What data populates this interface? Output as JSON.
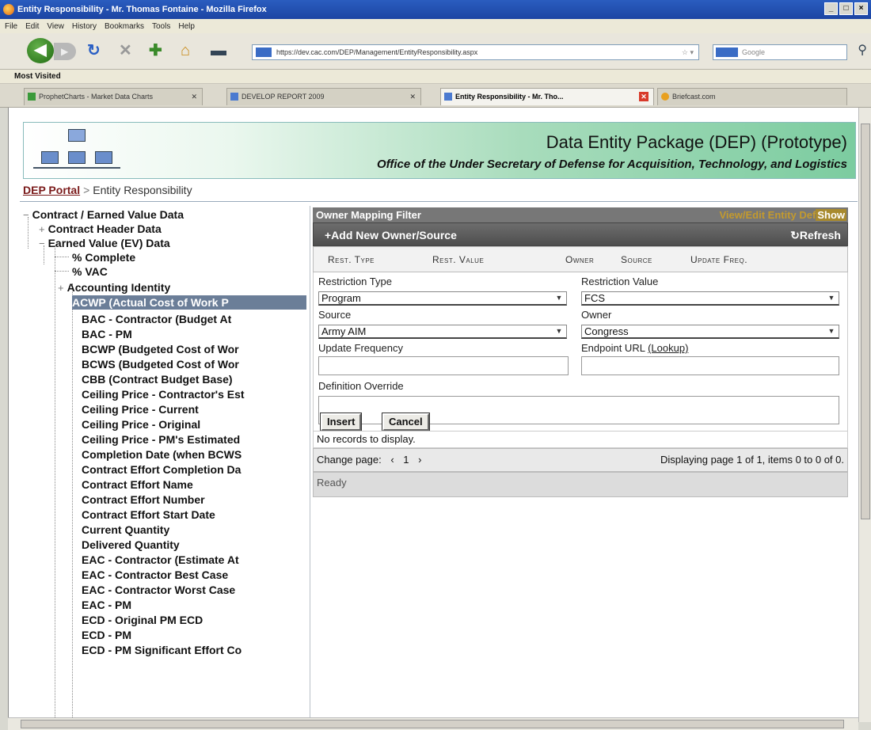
{
  "window": {
    "title": "Entity Responsibility - Mr. Thomas Fontaine - Mozilla Firefox",
    "controls": [
      "_",
      "□",
      "×"
    ]
  },
  "menu": [
    "File",
    "Edit",
    "View",
    "History",
    "Bookmarks",
    "Tools",
    "Help"
  ],
  "nav": {
    "url": "https://dev.cac.com/DEP/Management/EntityResponsibility.aspx",
    "search_placeholder": "Google"
  },
  "bookmarks": {
    "most_visited": "Most Visited"
  },
  "tabs": [
    {
      "label": "ProphetCharts - Market Data Charts"
    },
    {
      "label": "DEVELOP REPORT 2009"
    },
    {
      "label": "Entity Responsibility - Mr. Tho..."
    },
    {
      "label": "Briefcast.com"
    }
  ],
  "banner": {
    "title": "Data Entity Package (DEP) (Prototype)",
    "subtitle": "Office of the Under Secretary of Defense for Acquisition, Technology, and Logistics"
  },
  "breadcrumb": {
    "portal": "DEP Portal",
    "separator": ">",
    "current": "Entity Responsibility"
  },
  "tree": [
    {
      "label": "Contract / Earned Value Data",
      "expander": "−"
    },
    {
      "label": "Contract Header Data",
      "expander": "+"
    },
    {
      "label": "Earned Value (EV) Data",
      "expander": "−"
    },
    {
      "label": "% Complete"
    },
    {
      "label": "% VAC"
    },
    {
      "label": "Accounting Identity",
      "expander": "+"
    },
    {
      "label": "ACWP (Actual Cost of Work P"
    },
    {
      "label": "BAC - Contractor (Budget At"
    },
    {
      "label": "BAC - PM"
    },
    {
      "label": "BCWP (Budgeted Cost of Wor"
    },
    {
      "label": "BCWS (Budgeted Cost of Wor"
    },
    {
      "label": "CBB (Contract Budget Base)"
    },
    {
      "label": "Ceiling Price - Contractor's Est"
    },
    {
      "label": "Ceiling Price - Current"
    },
    {
      "label": "Ceiling Price - Original"
    },
    {
      "label": "Ceiling Price - PM's Estimated"
    },
    {
      "label": "Completion Date (when BCWS"
    },
    {
      "label": "Contract Effort Completion Da"
    },
    {
      "label": "Contract Effort Name"
    },
    {
      "label": "Contract Effort Number"
    },
    {
      "label": "Contract Effort Start Date"
    },
    {
      "label": "Current Quantity"
    },
    {
      "label": "Delivered Quantity"
    },
    {
      "label": "EAC - Contractor (Estimate At"
    },
    {
      "label": "EAC - Contractor Best Case"
    },
    {
      "label": "EAC - Contractor Worst Case"
    },
    {
      "label": "EAC - PM"
    },
    {
      "label": "ECD - Original PM ECD"
    },
    {
      "label": "ECD - PM"
    },
    {
      "label": "ECD - PM Significant Effort Co"
    }
  ],
  "panel": {
    "filter_title": "Owner Mapping Filter",
    "filter_link": "View/Edit Entity Def",
    "filter_show": "Show",
    "add_label": "+Add New Owner/Source",
    "refresh_label": "↻Refresh",
    "columns": [
      "Rest. Type",
      "Rest. Value",
      "Owner",
      "Source",
      "Update Freq."
    ],
    "form": {
      "restriction_type_label": "Restriction Type",
      "restriction_type_value": "Program",
      "restriction_value_label": "Restriction Value",
      "restriction_value_value": "FCS",
      "source_label": "Source",
      "source_value": "Army AIM",
      "owner_label": "Owner",
      "owner_value": "Congress",
      "update_freq_label": "Update Frequency",
      "update_freq_value": "",
      "endpoint_label": "Endpoint URL",
      "lookup_label": "(Lookup)",
      "endpoint_value": "",
      "definition_label": "Definition Override",
      "definition_value": "",
      "insert_label": "Insert",
      "cancel_label": "Cancel"
    },
    "no_records": "No records to display.",
    "pager_label": "Change page:",
    "pager_prev": "‹",
    "pager_page": "1",
    "pager_next": "›",
    "pager_info": "Displaying page 1 of 1, items 0 to 0 of 0.",
    "status": "Ready"
  }
}
